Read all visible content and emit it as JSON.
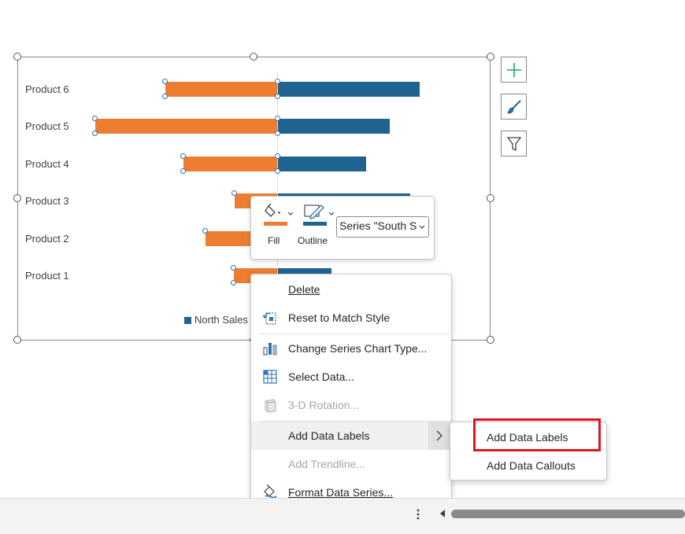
{
  "chart": {
    "categories": [
      "Product 6",
      "Product 5",
      "Product 4",
      "Product 3",
      "Product 2",
      "Product 1"
    ],
    "legend": {
      "north_label": "North Sales"
    },
    "colors": {
      "south": "#ED7D31",
      "north": "#1F6391"
    }
  },
  "chart_side_buttons": {
    "elements_icon": "plus-icon",
    "styles_icon": "brush-icon",
    "filter_icon": "funnel-icon"
  },
  "mini_toolbar": {
    "fill_label": "Fill",
    "outline_label": "Outline",
    "series_select_value": "Series \"South S"
  },
  "context_menu": {
    "delete": "Delete",
    "reset_to_match_style": "Reset to Match Style",
    "change_series_chart_type": "Change Series Chart Type...",
    "select_data": "Select Data...",
    "rotation_3d": "3-D Rotation...",
    "add_data_labels": "Add Data Labels",
    "add_trendline": "Add Trendline...",
    "format_data_series": "Format Data Series..."
  },
  "submenu": {
    "add_data_labels": "Add Data Labels",
    "add_data_callouts": "Add Data Callouts"
  },
  "highlight_color": "#E0161E"
}
